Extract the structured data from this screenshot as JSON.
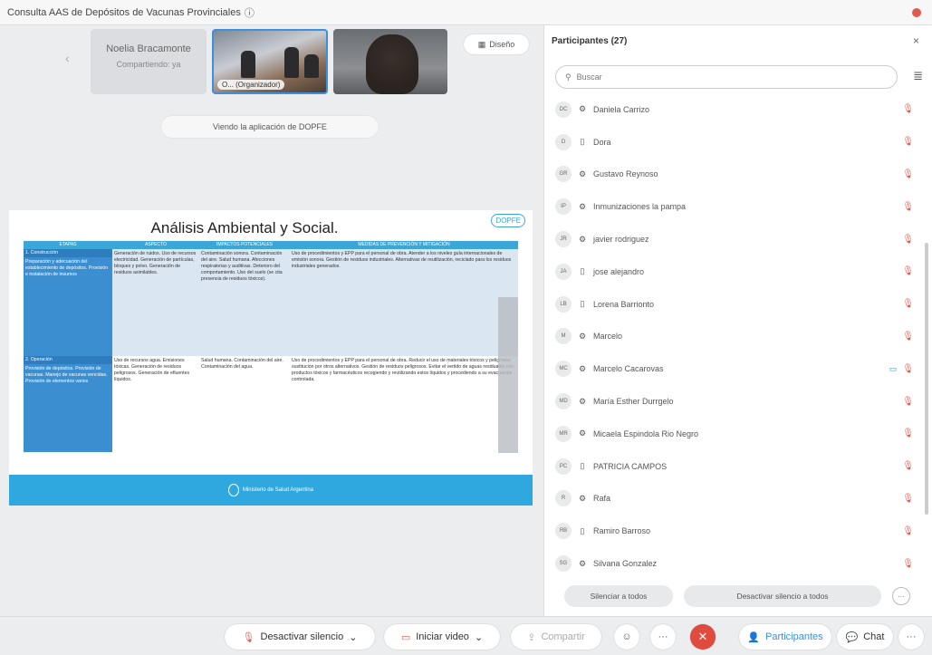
{
  "window": {
    "title": "Consulta AAS de Depósitos de Vacunas Provinciales"
  },
  "stage": {
    "thumbs": [
      {
        "name": "Noelia Bracamonte",
        "sub": "Compartiendo: ya"
      },
      {
        "label": "O... (Organizador)"
      }
    ],
    "layout_label": "Diseño",
    "viewing_label": "Viendo la aplicación de DOPFE"
  },
  "slide": {
    "title": "Análisis Ambiental y Social.",
    "headers": [
      "ETAPAS",
      "ASPECTO",
      "IMPACTOS POTENCIALES",
      "MEDIDAS DE PREVENCIÓN Y MITIGACIÓN"
    ],
    "rows": [
      {
        "c1": "1. Construcción",
        "c1b": "Preparación y adecuación del establecimiento de depósitos. Provisión e instalación de insumos",
        "c2": "Generación de ruidos. Uso de recursos electricidad. Generación de partículas, bloques y polvo. Generación de residuos asimilables.",
        "c3": "Contaminación sonora. Contaminación del aire. Salud humana. Afecciones respiratorias y auditivas. Deterioro del comportamiento. Uso del suelo (se cita presencia de residuos tóxicos).",
        "c4": "Uso de procedimientos y EPP para el personal de obra. Atender a los niveles guía internacionales de emisión sonora. Gestión de residuos industriales. Alternativas de reutilización, reciclado para los residuos industriales generados."
      },
      {
        "c1": "2. Operación",
        "c1b": "Provisión de depósitos. Provisión de vacunas. Manejo de vacunas vencidas. Provisión de elementos varios",
        "c2": "Uso de recursos agua. Emisiones tóxicas. Generación de residuos peligrosos. Generación de efluentes líquidos.",
        "c3": "Salud humana. Contaminación del aire. Contaminación del agua.",
        "c4": "Uso de procedimientos y EPP para el personal de obra. Reducir el uso de materiales tóxicos y peligrosos sustitución por otros alternativos. Gestión de residuos peligrosos. Evitar el vertido de aguas residuales con productos tóxicos y farmacéuticos recogiendo y reutilizando estos líquidos y procediendo a su evacuación controlada."
      }
    ],
    "footer": "Ministerio de Salud Argentina"
  },
  "participants": {
    "title": "Participantes (27)",
    "search_placeholder": "Buscar",
    "list": [
      {
        "initials": "DC",
        "name": "Daniela Carrizo",
        "device": "app"
      },
      {
        "initials": "D",
        "name": "Dora",
        "device": "phone"
      },
      {
        "initials": "GR",
        "name": "Gustavo Reynoso",
        "device": "app"
      },
      {
        "initials": "IP",
        "name": "Inmunizaciones la pampa",
        "device": "app"
      },
      {
        "initials": "JR",
        "name": "javier rodriguez",
        "device": "app"
      },
      {
        "initials": "JA",
        "name": "jose alejandro",
        "device": "phone"
      },
      {
        "initials": "LB",
        "name": "Lorena Barrionto",
        "device": "phone"
      },
      {
        "initials": "M",
        "name": "Marcelo",
        "device": "app"
      },
      {
        "initials": "MC",
        "name": "Marcelo Cacarovas",
        "device": "app",
        "camera_off": true
      },
      {
        "initials": "MD",
        "name": "María Esther Durrgelo",
        "device": "app"
      },
      {
        "initials": "MR",
        "name": "Micaela Espindola Rio Negro",
        "device": "app"
      },
      {
        "initials": "PC",
        "name": "PATRICIA CAMPOS",
        "device": "phone"
      },
      {
        "initials": "R",
        "name": "Rafa",
        "device": "app"
      },
      {
        "initials": "RB",
        "name": "Ramiro Barroso",
        "device": "phone"
      },
      {
        "initials": "SG",
        "name": "Silvana Gonzalez",
        "device": "app"
      }
    ],
    "mute_all": "Silenciar a todos",
    "unmute_all": "Desactivar silencio a todos"
  },
  "toolbar": {
    "unmute": "Desactivar silencio",
    "start_video": "Iniciar video",
    "share": "Compartir",
    "participants": "Participantes",
    "chat": "Chat"
  },
  "colors": {
    "accent": "#3d8fe0",
    "danger": "#e05a4f",
    "slide_blue": "#3ba7d9"
  }
}
